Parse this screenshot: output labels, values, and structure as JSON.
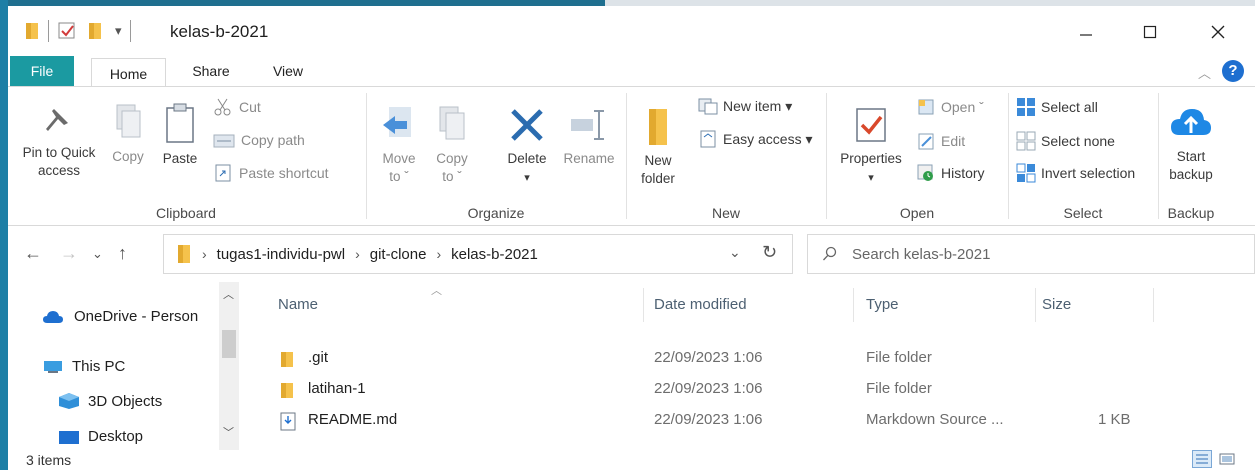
{
  "window": {
    "title": "kelas-b-2021",
    "qa_dropdown": "▾"
  },
  "tabs": [
    {
      "label": "File"
    },
    {
      "label": "Home"
    },
    {
      "label": "Share"
    },
    {
      "label": "View"
    }
  ],
  "ribbon": {
    "clipboard": {
      "label": "Clipboard",
      "pin_line1": "Pin to Quick",
      "pin_line2": "access",
      "copy": "Copy",
      "paste": "Paste",
      "cut": "Cut",
      "copy_path": "Copy path",
      "paste_shortcut": "Paste shortcut"
    },
    "organize": {
      "label": "Organize",
      "move_line1": "Move",
      "move_line2": "to ˇ",
      "copy_line1": "Copy",
      "copy_line2": "to ˇ",
      "delete": "Delete",
      "rename": "Rename"
    },
    "new": {
      "label": "New",
      "folder_line1": "New",
      "folder_line2": "folder",
      "new_item": "New item ▾",
      "easy_access": "Easy access ▾"
    },
    "open": {
      "label": "Open",
      "properties": "Properties",
      "open": "Open ˇ",
      "edit": "Edit",
      "history": "History"
    },
    "select": {
      "label": "Select",
      "select_all": "Select all",
      "select_none": "Select none",
      "invert": "Invert selection"
    },
    "backup": {
      "label": "Backup",
      "start_line1": "Start",
      "start_line2": "backup"
    }
  },
  "address": {
    "crumbs": [
      "tugas1-individu-pwl",
      "git-clone",
      "kelas-b-2021"
    ],
    "search_placeholder": "Search kelas-b-2021"
  },
  "navpane": {
    "items": [
      "OneDrive - Person",
      "This PC",
      "3D Objects",
      "Desktop"
    ]
  },
  "filelist": {
    "columns": {
      "name": "Name",
      "date": "Date modified",
      "type": "Type",
      "size": "Size"
    },
    "rows": [
      {
        "name": ".git",
        "date": "22/09/2023 1:06",
        "type": "File folder",
        "size": "",
        "icon": "folder-icon"
      },
      {
        "name": "latihan-1",
        "date": "22/09/2023 1:06",
        "type": "File folder",
        "size": "",
        "icon": "folder-icon"
      },
      {
        "name": "README.md",
        "date": "22/09/2023 1:06",
        "type": "Markdown Source ...",
        "size": "1 KB",
        "icon": "markdown-file-icon"
      }
    ]
  },
  "status": {
    "count": "3 items"
  },
  "colors": {
    "file_tab": "#1b9aa1",
    "folder": "#f5c24c",
    "accent_blue": "#1e88e5",
    "delete_blue": "#2b6cb0"
  }
}
